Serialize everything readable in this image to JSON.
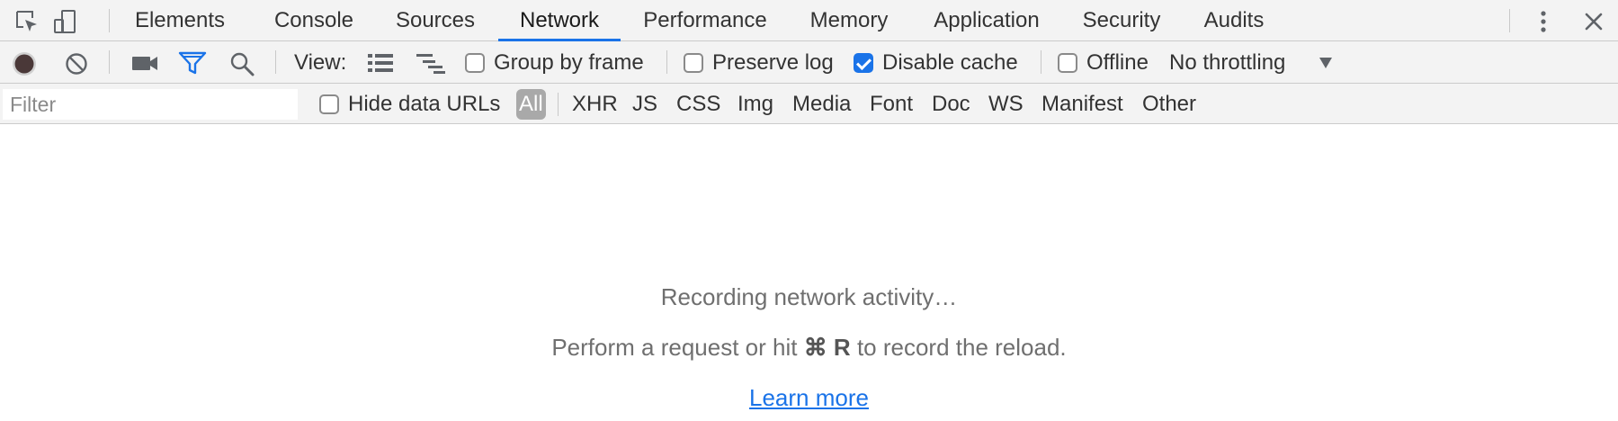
{
  "tabs": [
    "Elements",
    "Console",
    "Sources",
    "Network",
    "Performance",
    "Memory",
    "Application",
    "Security",
    "Audits"
  ],
  "active_tab": "Network",
  "icons": {
    "inspect": "inspect-element-icon",
    "device": "device-toolbar-icon",
    "more": "more-vertical-icon",
    "close": "close-icon",
    "record": "record-icon",
    "clear": "clear-icon",
    "capture": "camera-icon",
    "filter": "filter-icon",
    "search": "search-icon",
    "large_rows": "list-view-icon",
    "waterfall": "waterfall-view-icon",
    "throttle_arrow": "dropdown-arrow-icon"
  },
  "toolbar": {
    "view_label": "View:",
    "group_by_frame": {
      "label": "Group by frame",
      "checked": false
    },
    "preserve_log": {
      "label": "Preserve log",
      "checked": false
    },
    "disable_cache": {
      "label": "Disable cache",
      "checked": true
    },
    "offline": {
      "label": "Offline",
      "checked": false
    },
    "throttling": "No throttling"
  },
  "filterbar": {
    "placeholder": "Filter",
    "hide_data_urls": {
      "label": "Hide data URLs",
      "checked": false
    },
    "types": [
      "All",
      "XHR",
      "JS",
      "CSS",
      "Img",
      "Media",
      "Font",
      "Doc",
      "WS",
      "Manifest",
      "Other"
    ],
    "selected_type": "All"
  },
  "empty_state": {
    "line1": "Recording network activity…",
    "line2_prefix": "Perform a request or hit",
    "shortcut": "⌘ R",
    "line2_suffix": "to record the reload.",
    "link": "Learn more"
  },
  "colors": {
    "accent": "#1a73e8",
    "toolbar_bg": "#f3f3f3",
    "record_dot": "#4a3838",
    "selected_type_bg": "#a9a9a9"
  }
}
